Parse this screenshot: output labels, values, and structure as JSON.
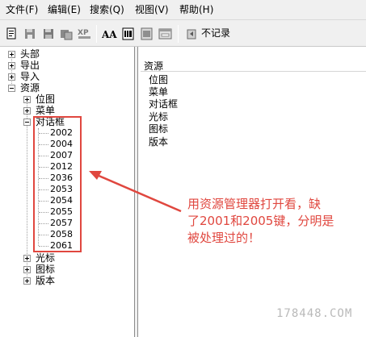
{
  "menu": {
    "file": "文件(F)",
    "edit": "编辑(E)",
    "search": "搜索(Q)",
    "view": "视图(V)",
    "help": "帮助(H)"
  },
  "toolbar": {
    "buttons": [
      "new-file-icon",
      "open-icon",
      "save-icon",
      "save-as-icon",
      "xp-icon",
      "font-aa-icon",
      "string-table-icon",
      "resource-image-icon",
      "dialog-icon",
      "undo-icon"
    ],
    "xp_label": "XP",
    "font_label": "AA",
    "undo_label": "不记录"
  },
  "tree": {
    "header": "头部",
    "export": "导出",
    "import": "导入",
    "resources": "资源",
    "bitmap": "位图",
    "menu": "菜单",
    "dialog": "对话框",
    "dialog_ids": [
      "2002",
      "2004",
      "2007",
      "2012",
      "2036",
      "2053",
      "2054",
      "2055",
      "2057",
      "2058",
      "2061"
    ],
    "cursor": "光标",
    "icon": "图标",
    "version": "版本"
  },
  "list": {
    "header": "资源",
    "items": [
      "位图",
      "菜单",
      "对话框",
      "光标",
      "图标",
      "版本"
    ]
  },
  "annotation": {
    "line1": "用资源管理器打开看，缺",
    "line2": "了2001和2005键，分明是",
    "line3": "被处理过的！"
  },
  "watermark": "178448.COM",
  "colors": {
    "annotation": "#e0473f",
    "chrome": "#f0f0f0"
  }
}
